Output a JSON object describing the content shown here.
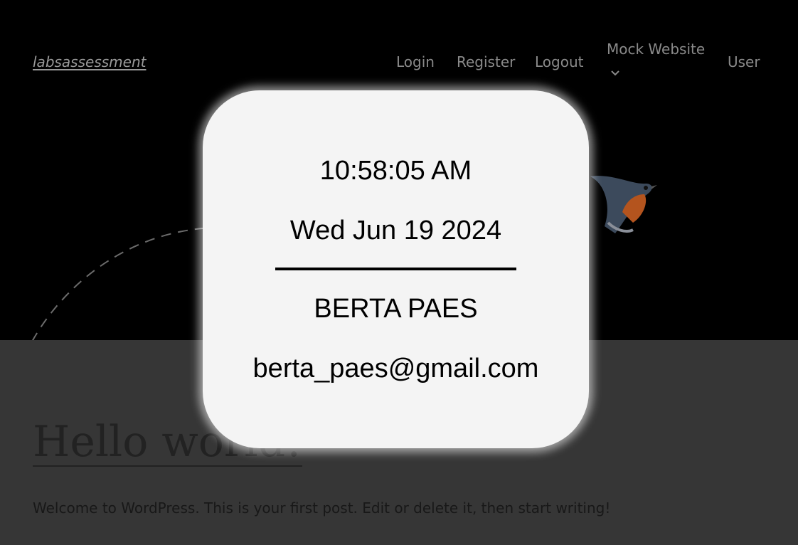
{
  "header": {
    "site_title": "labsassessment",
    "nav": {
      "login": "Login",
      "register": "Register",
      "logout": "Logout",
      "mock_website": "Mock Website",
      "user": "User"
    }
  },
  "post": {
    "title": "Hello world!",
    "excerpt": "Welcome to WordPress. This is your first post. Edit or delete it, then start writing!"
  },
  "overlay": {
    "time": "10:58:05 AM",
    "date": "Wed Jun 19 2024",
    "name": "BERTA PAES",
    "email": "berta_paes@gmail.com"
  }
}
